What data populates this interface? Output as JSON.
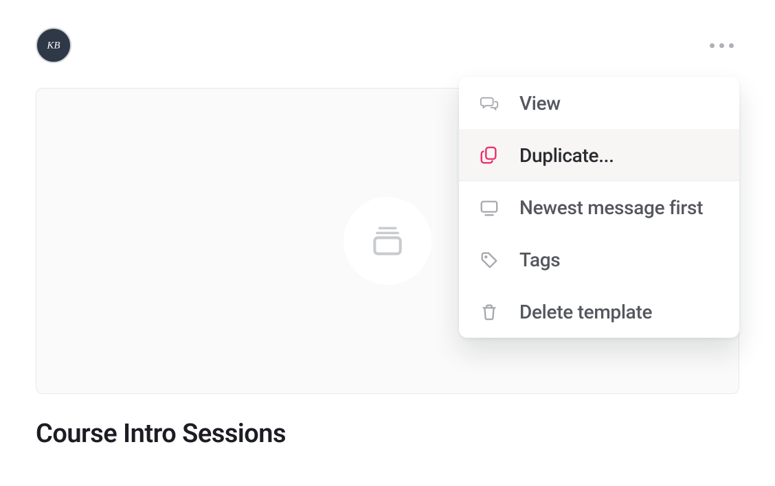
{
  "header": {
    "avatar_initials": "KB"
  },
  "card": {
    "title": "Course Intro Sessions"
  },
  "menu": {
    "items": [
      {
        "label": "View",
        "icon": "chat-icon",
        "selected": false
      },
      {
        "label": "Duplicate...",
        "icon": "copy-icon",
        "selected": true
      },
      {
        "label": "Newest message first",
        "icon": "monitor-icon",
        "selected": false
      },
      {
        "label": "Tags",
        "icon": "tag-icon",
        "selected": false
      },
      {
        "label": "Delete template",
        "icon": "trash-icon",
        "selected": false
      }
    ]
  }
}
